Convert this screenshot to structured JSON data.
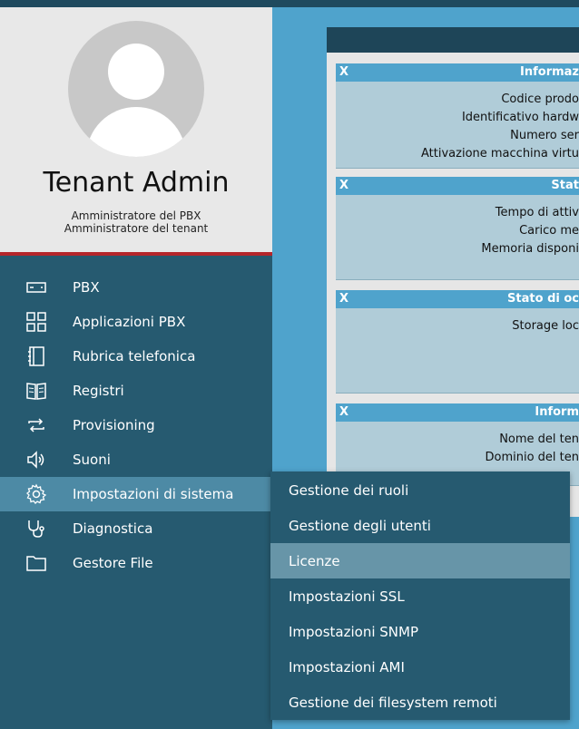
{
  "profile": {
    "name": "Tenant Admin",
    "roles": [
      "Amministratore del PBX",
      "Amministratore del tenant"
    ]
  },
  "menu": {
    "items": [
      {
        "label": "PBX",
        "icon": "server-icon"
      },
      {
        "label": "Applicazioni PBX",
        "icon": "grid-icon"
      },
      {
        "label": "Rubrica telefonica",
        "icon": "address-book-icon"
      },
      {
        "label": "Registri",
        "icon": "book-icon"
      },
      {
        "label": "Provisioning",
        "icon": "provisioning-icon"
      },
      {
        "label": "Suoni",
        "icon": "speaker-icon"
      },
      {
        "label": "Impostazioni di sistema",
        "icon": "gear-icon",
        "active": true
      },
      {
        "label": "Diagnostica",
        "icon": "stethoscope-icon"
      },
      {
        "label": "Gestore File",
        "icon": "folder-icon"
      }
    ]
  },
  "submenu": {
    "items": [
      {
        "label": "Gestione dei ruoli"
      },
      {
        "label": "Gestione degli utenti"
      },
      {
        "label": "Licenze",
        "active": true
      },
      {
        "label": "Impostazioni SSL"
      },
      {
        "label": "Impostazioni SNMP"
      },
      {
        "label": "Impostazioni AMI"
      },
      {
        "label": "Gestione dei filesystem remoti"
      }
    ]
  },
  "cards": [
    {
      "close": "X",
      "title": "Informaz",
      "rows": [
        "Codice prodo",
        "Identificativo hardw",
        "Numero ser",
        "Attivazione macchina virtu"
      ]
    },
    {
      "close": "X",
      "title": "Stat",
      "rows": [
        "Tempo di attiv",
        "Carico me",
        "Memoria disponi"
      ]
    },
    {
      "close": "X",
      "title": "Stato di oc",
      "rows": [
        "Storage loc"
      ]
    },
    {
      "close": "X",
      "title": "Inform",
      "rows": [
        "Nome del ten",
        "Dominio del ten"
      ]
    }
  ],
  "colors": {
    "sidebar": "#265a70",
    "accent": "#4fa3cc",
    "profile_border": "#b5262b",
    "active_item": "#4d8aa5"
  }
}
